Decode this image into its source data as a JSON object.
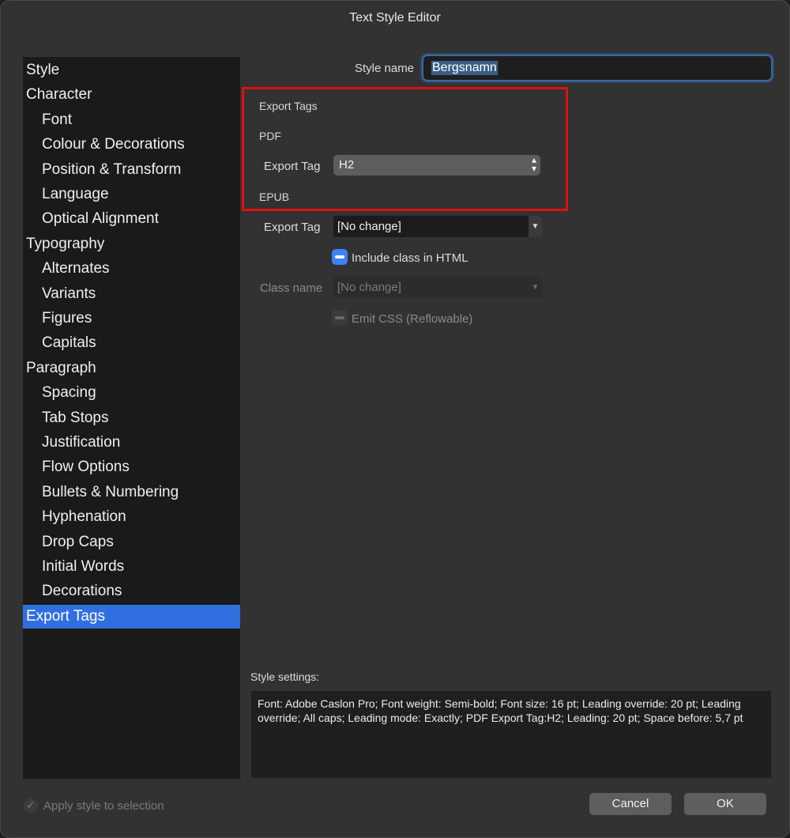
{
  "window": {
    "title": "Text Style Editor"
  },
  "sidebar": {
    "items": [
      {
        "label": "Style",
        "level": 0
      },
      {
        "label": "Character",
        "level": 0
      },
      {
        "label": "Font",
        "level": 1
      },
      {
        "label": "Colour & Decorations",
        "level": 1
      },
      {
        "label": "Position & Transform",
        "level": 1
      },
      {
        "label": "Language",
        "level": 1
      },
      {
        "label": "Optical Alignment",
        "level": 1
      },
      {
        "label": "Typography",
        "level": 0
      },
      {
        "label": "Alternates",
        "level": 1
      },
      {
        "label": "Variants",
        "level": 1
      },
      {
        "label": "Figures",
        "level": 1
      },
      {
        "label": "Capitals",
        "level": 1
      },
      {
        "label": "Paragraph",
        "level": 0
      },
      {
        "label": "Spacing",
        "level": 1
      },
      {
        "label": "Tab Stops",
        "level": 1
      },
      {
        "label": "Justification",
        "level": 1
      },
      {
        "label": "Flow Options",
        "level": 1
      },
      {
        "label": "Bullets & Numbering",
        "level": 1
      },
      {
        "label": "Hyphenation",
        "level": 1
      },
      {
        "label": "Drop Caps",
        "level": 1
      },
      {
        "label": "Initial Words",
        "level": 1
      },
      {
        "label": "Decorations",
        "level": 1
      },
      {
        "label": "Export Tags",
        "level": 0,
        "selected": true
      }
    ]
  },
  "main": {
    "style_name_label": "Style name",
    "style_name_value": "Bergsnamn",
    "section_title": "Export Tags",
    "pdf": {
      "title": "PDF",
      "export_tag_label": "Export Tag",
      "export_tag_value": "H2"
    },
    "epub": {
      "title": "EPUB",
      "export_tag_label": "Export Tag",
      "export_tag_value": "[No change]",
      "include_class_label": "Include class in HTML",
      "include_class_checked": true,
      "class_name_label": "Class name",
      "class_name_value": "[No change]",
      "emit_css_label": "Emit CSS (Reflowable)",
      "emit_css_enabled": false
    },
    "style_settings_label": "Style settings:",
    "style_settings_text": "Font: Adobe Caslon Pro; Font weight: Semi-bold; Font size: 16 pt; Leading override: 20 pt; Leading override; All caps; Leading mode: Exactly; PDF Export Tag:H2; Leading: 20 pt; Space before: 5,7 pt"
  },
  "footer": {
    "apply_style_label": "Apply style to selection",
    "cancel_label": "Cancel",
    "ok_label": "OK"
  },
  "colors": {
    "accent": "#2f6fe0",
    "highlight_box": "#e01010"
  }
}
